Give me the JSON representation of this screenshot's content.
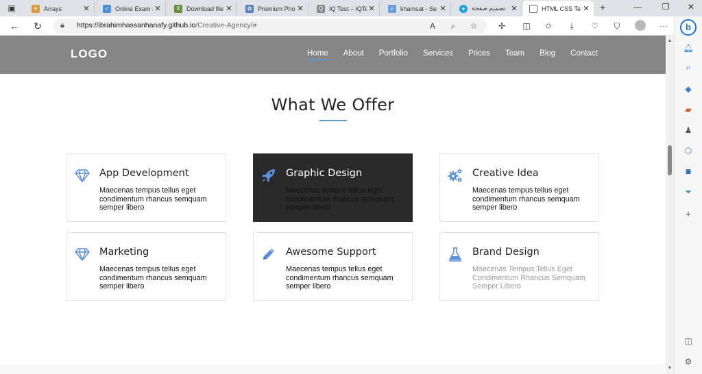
{
  "browser": {
    "tabs": [
      {
        "title": "Arrays",
        "favicon_color": "#d99a3c"
      },
      {
        "title": "Online Exam S",
        "favicon_color": "#4a90d9"
      },
      {
        "title": "Download file",
        "favicon_color": "#6a8f3a"
      },
      {
        "title": "Premium Pho",
        "favicon_color": "#5b7fbf"
      },
      {
        "title": "IQ Test – IQTe",
        "favicon_color": "#8a8a8a"
      },
      {
        "title": "khamsat - Se",
        "favicon_color": "#6aa0d8"
      },
      {
        "title": "تصميم صفحة",
        "favicon_color": "#1aa3e0"
      },
      {
        "title": "HTML CSS Te",
        "favicon_color": "#444444"
      }
    ],
    "active_tab_index": 7,
    "url_host": "https://ibrahimhassanhanafy.github.io",
    "url_path": "/Creative-Agency/#"
  },
  "site": {
    "logo": "LOGO",
    "menu": [
      "Home",
      "About",
      "Portfolio",
      "Services",
      "Prices",
      "Team",
      "Blog",
      "Contact"
    ],
    "active_menu": "Home",
    "section_title": "What We Offer",
    "accent_color": "#5b9bd5",
    "header_color": "#858585",
    "cards": [
      {
        "title": "App Development",
        "text": "Maecenas tempus tellus eget condimentum rhancus semquam semper libero",
        "icon": "diamond-icon"
      },
      {
        "title": "Graphic Design",
        "text": "Maecenas tempus tellus eget condimentum rhancus semquam semper libero",
        "icon": "rocket-icon"
      },
      {
        "title": "Creative Idea",
        "text": "Maecenas tempus tellus eget condimentum rhancus semquam semper libero",
        "icon": "gears-icon"
      },
      {
        "title": "Marketing",
        "text": "Maecenas tempus tellus eget condimentum rhancus semquam semper libero",
        "icon": "diamond-icon"
      },
      {
        "title": "Awesome Support",
        "text": "Maecenas tempus tellus eget condimentum rhancus semquam semper libero",
        "icon": "pencil-icon"
      },
      {
        "title": "Brand Design",
        "text": "Maecenas Tempus Tellus Eget Condimentum Rhancus Semquam Semper Libero",
        "icon": "flask-icon"
      }
    ]
  }
}
